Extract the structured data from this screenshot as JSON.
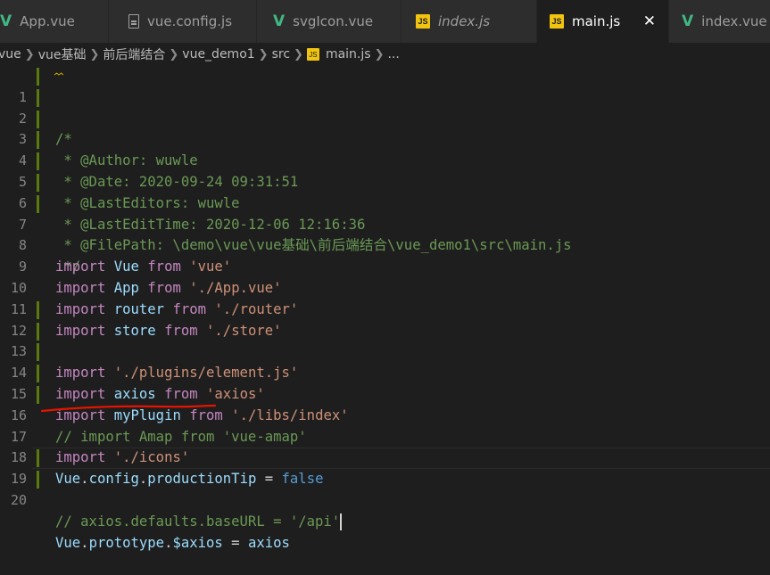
{
  "tabs": [
    {
      "label": "App.vue",
      "icon": "vue-icon"
    },
    {
      "label": "vue.config.js",
      "icon": "file-icon"
    },
    {
      "label": "svgIcon.vue",
      "icon": "vue-icon"
    },
    {
      "label": "index.js",
      "icon": "js-icon"
    },
    {
      "label": "main.js",
      "icon": "js-icon",
      "close": "✕"
    },
    {
      "label": "index.vue",
      "icon": "vue-icon"
    }
  ],
  "icons": {
    "js_text": "JS",
    "vue_glyph": "V"
  },
  "breadcrumb": [
    "vue",
    "vue基础",
    "前后端结合",
    "vue_demo1",
    "src",
    "main.js",
    "..."
  ],
  "gutter": {
    "numbers": [
      "1",
      "2",
      "3",
      "4",
      "5",
      "6",
      "7",
      "8",
      "9",
      "10",
      "11",
      "12",
      "13",
      "14",
      "15",
      "16",
      "17",
      "18",
      "19",
      "20"
    ]
  },
  "code": {
    "l1": "/*",
    "l2": " * @Author: wuwle",
    "l3": " * @Date: 2020-09-24 09:31:51",
    "l4": " * @LastEditors: wuwle",
    "l5": " * @LastEditTime: 2020-12-06 12:16:36",
    "l6": " * @FilePath: \\demo\\vue\\vue基础\\前后端结合\\vue_demo1\\src\\main.js",
    "l7": " */",
    "import": "import",
    "from": "from",
    "vue_name": "Vue",
    "vue_path": "'vue'",
    "app_name": "App",
    "app_path": "'./App.vue'",
    "router_name": "router",
    "router_path": "'./router'",
    "store_name": "store",
    "store_path": "'./store'",
    "element_path": "'./plugins/element.js'",
    "axios_name": "axios",
    "axios_path": "'axios'",
    "myplugin_name": "myPlugin",
    "myplugin_path": "'./libs/index'",
    "l15": "// import Amap from 'vue-amap'",
    "icons_path": "'./icons'",
    "l18_obj": "Vue",
    "l18_dot1": ".",
    "l18_config": "config",
    "l18_dot2": ".",
    "l18_prop": "productionTip",
    "l18_eq": " = ",
    "l18_val": "false",
    "l19": "// axios.defaults.baseURL = '/api'",
    "l20_obj": "Vue",
    "l20_dot1": ".",
    "l20_proto": "prototype",
    "l20_dot2": ".",
    "l20_prop": "$axios",
    "l20_eq": " = ",
    "l20_val": "axios"
  },
  "colors": {
    "keyword": "#c586c0",
    "string": "#ce9178",
    "variable": "#9cdcfe",
    "comment": "#6a9955",
    "boolean": "#569cd6",
    "annotation": "#e51400",
    "gutter_modified": "#587c0c"
  }
}
